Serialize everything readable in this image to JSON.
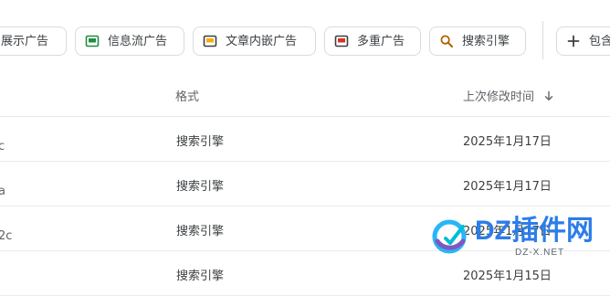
{
  "toolbar": {
    "chips": {
      "display": {
        "label": "展示广告"
      },
      "feed": {
        "label": "信息流广告"
      },
      "inarticle": {
        "label": "文章内嵌广告"
      },
      "multiplex": {
        "label": "多重广告"
      },
      "search": {
        "label": "搜索引擎"
      },
      "contains": {
        "label": "包含"
      }
    }
  },
  "table": {
    "columns": {
      "format": "格式",
      "modified": "上次修改时间"
    },
    "rows": [
      {
        "name": "c",
        "format": "搜索引擎",
        "modified": "2025年1月17日"
      },
      {
        "name": "a",
        "format": "搜索引擎",
        "modified": "2025年1月17日"
      },
      {
        "name": "2c",
        "format": "搜索引擎",
        "modified": "2025年1月17日"
      },
      {
        "name": "",
        "format": "搜索引擎",
        "modified": "2025年1月15日"
      }
    ]
  },
  "watermark": {
    "brand": "DZ插件网",
    "domain": "DZ-X.NET"
  },
  "colors": {
    "accent": "#1a73e8",
    "chip_border": "#d7dbe0",
    "feed_icon": "#1e8e3e",
    "inarticle_icon": "#f9ab00",
    "multiplex_icon": "#d93025",
    "search_icon": "#b06000"
  }
}
